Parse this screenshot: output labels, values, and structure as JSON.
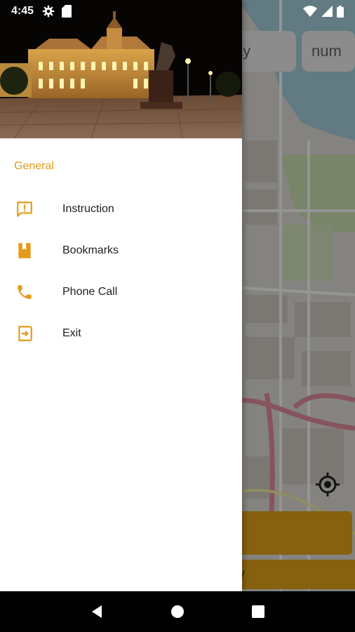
{
  "status_bar": {
    "time": "4:45",
    "left_icons": [
      "settings-icon",
      "sd-card-icon"
    ],
    "right_icons": [
      "wifi-icon",
      "signal-icon",
      "battery-icon"
    ]
  },
  "drawer": {
    "section_title": "General",
    "items": [
      {
        "label": "Instruction",
        "icon": "feedback-icon"
      },
      {
        "label": "Bookmarks",
        "icon": "bookmark-book-icon"
      },
      {
        "label": "Phone Call",
        "icon": "phone-icon"
      },
      {
        "label": "Exit",
        "icon": "exit-icon"
      }
    ]
  },
  "map_app": {
    "search_day_fragment": "ay",
    "search_num_placeholder": "num",
    "bottom_bar_fragment": "y"
  },
  "nav_bar": {
    "buttons": [
      "back-icon",
      "home-icon",
      "recents-icon"
    ]
  },
  "colors": {
    "accent": "#e39b1d",
    "primary_bar": "#e8a81a",
    "drawer_bg": "#ffffff",
    "text": "#212121"
  }
}
